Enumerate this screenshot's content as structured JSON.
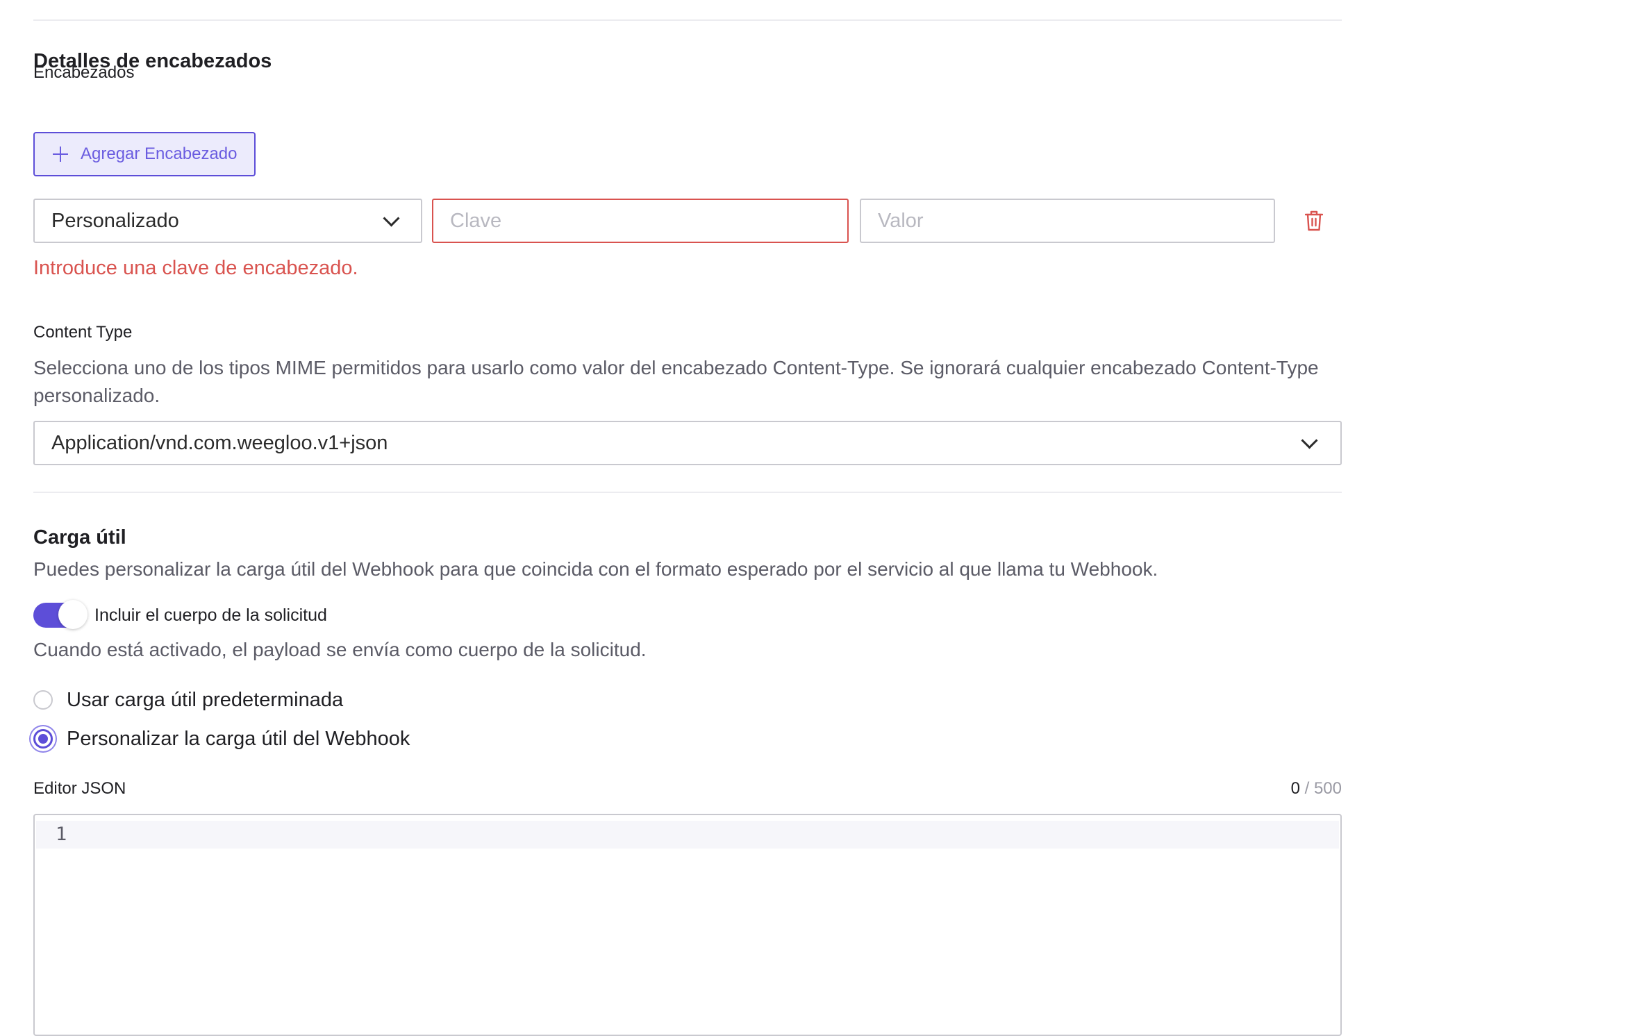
{
  "header_details": {
    "title": "Detalles de encabezados",
    "headers_label": "Encabezados",
    "add_header_label": "Agregar Encabezado",
    "header_row": {
      "type_value": "Personalizado",
      "key_placeholder": "Clave",
      "value_placeholder": "Valor",
      "error": "Introduce una clave de encabezado."
    },
    "content_type": {
      "label": "Content Type",
      "description": "Selecciona uno de los tipos MIME permitidos para usarlo como valor del encabezado Content-Type. Se ignorará cualquier encabezado Content-Type personalizado.",
      "selected": "Application/vnd.com.weegloo.v1+json"
    }
  },
  "payload": {
    "title": "Carga útil",
    "description": "Puedes personalizar la carga útil del Webhook para que coincida con el formato esperado por el servicio al que llama tu Webhook.",
    "toggle_label": "Incluir el cuerpo de la solicitud",
    "toggle_on": true,
    "toggle_help": "Cuando está activado, el payload se envía como cuerpo de la solicitud.",
    "options": [
      {
        "label": "Usar carga útil predeterminada",
        "checked": false
      },
      {
        "label": "Personalizar la carga útil del Webhook",
        "checked": true
      }
    ],
    "json_editor": {
      "label": "Editor JSON",
      "count": "0",
      "max": " / 500",
      "line_number": "1"
    }
  },
  "colors": {
    "accent": "#5d4ed8",
    "error": "#d9534f",
    "border": "#c9c9cf"
  },
  "icons": [
    "plus-icon",
    "chevron-down-icon",
    "trash-icon"
  ]
}
